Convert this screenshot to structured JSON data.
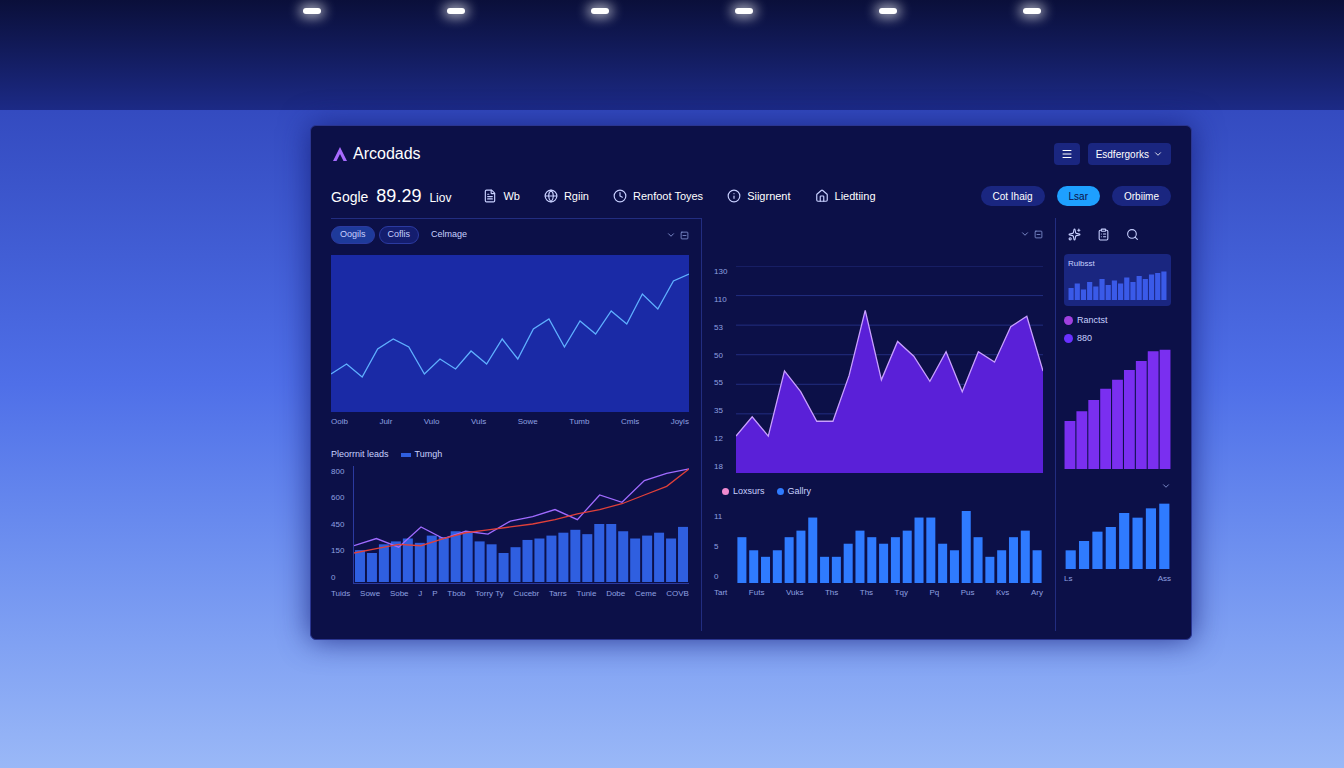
{
  "header": {
    "logo": "Arcodads",
    "dropdown": "Esdfergorks"
  },
  "toolbar": {
    "ticker": "Gogle",
    "value": "89.29",
    "unit": "Liov",
    "nav": [
      {
        "label": "Wb"
      },
      {
        "label": "Rgiin"
      },
      {
        "label": "Renfoot Toyes"
      },
      {
        "label": "Siigrnent"
      },
      {
        "label": "Liedtiing"
      }
    ],
    "buttons": [
      {
        "label": "Cot Ihaig",
        "selected": false
      },
      {
        "label": "Lsar",
        "selected": true
      },
      {
        "label": "Orbiime",
        "selected": false
      }
    ]
  },
  "left_panel": {
    "tabs": [
      {
        "label": "Oogils",
        "kind": "pill",
        "selected": true
      },
      {
        "label": "Coflis",
        "kind": "pill",
        "selected": false
      },
      {
        "label": "Celmage",
        "kind": "text",
        "selected": false
      }
    ],
    "trend_chart": {
      "values": [
        35,
        45,
        32,
        60,
        70,
        62,
        35,
        50,
        40,
        58,
        45,
        70,
        50,
        80,
        90,
        62,
        88,
        75,
        98,
        85,
        115,
        100,
        128,
        135
      ],
      "x_labels": [
        "Ooib",
        "Julr",
        "Vulo",
        "Vuls",
        "Sowe",
        "Tumb",
        "Cmls",
        "Joyls"
      ]
    },
    "leads_chart": {
      "title": "Pleorrnit leads",
      "legend": [
        {
          "label": "Tumgh",
          "color": "#2f5fe0"
        }
      ],
      "y_ticks": [
        "800",
        "600",
        "450",
        "150",
        "0"
      ],
      "bars": [
        220,
        200,
        260,
        280,
        300,
        270,
        320,
        310,
        350,
        340,
        280,
        260,
        200,
        240,
        290,
        300,
        320,
        340,
        360,
        330,
        400,
        400,
        350,
        300,
        320,
        340,
        300,
        380
      ],
      "lines": [
        {
          "values": [
            250,
            300,
            240,
            380,
            300,
            350,
            330,
            420,
            450,
            500,
            430,
            600,
            550,
            700,
            750,
            780
          ],
          "color": "#a06bff"
        },
        {
          "values": [
            200,
            230,
            260,
            250,
            300,
            340,
            360,
            380,
            400,
            430,
            470,
            500,
            540,
            600,
            660,
            780
          ],
          "color": "#e0403a"
        }
      ],
      "x_labels": [
        "Tuids",
        "Sowe",
        "Sobe",
        "J",
        "P",
        "Tbob",
        "Torry Ty",
        "Cucebr",
        "Tarrs",
        "Tunie",
        "Dobe",
        "Ceme",
        "COVB"
      ]
    }
  },
  "middle_panel": {
    "area_chart": {
      "y_ticks": [
        "130",
        "110",
        "53",
        "50",
        "55",
        "35",
        "12",
        "18"
      ],
      "values": [
        25,
        38,
        25,
        69,
        55,
        35,
        35,
        66,
        110,
        63,
        89,
        79,
        62,
        82,
        55,
        82,
        75,
        99,
        106,
        69
      ]
    },
    "legend": [
      {
        "label": "Loxsurs",
        "color": "#f08ad0"
      },
      {
        "label": "Gallry",
        "color": "#2f7bff"
      }
    ],
    "bar_chart": {
      "y_ticks": [
        "11",
        "5",
        "0"
      ],
      "values": [
        7,
        5,
        4,
        5,
        7,
        8,
        10,
        4,
        4,
        6,
        8,
        7,
        6,
        7,
        8,
        10,
        10,
        6,
        5,
        11,
        7,
        4,
        5,
        7,
        8,
        5
      ],
      "x_labels": [
        "Tart",
        "Futs",
        "Vuks",
        "Ths",
        "Ths",
        "Tqy",
        "Pq",
        "Pus",
        "Kvs",
        "Ary"
      ]
    }
  },
  "right_panel": {
    "mini_card": {
      "title": "Rulbsst",
      "values": [
        40,
        55,
        35,
        60,
        45,
        70,
        50,
        65,
        55,
        75,
        60,
        80,
        70,
        85,
        90,
        95
      ]
    },
    "legend": [
      {
        "label": "Ranctst",
        "color": "#a040e0"
      },
      {
        "label": "880",
        "color": "#6a30ff"
      }
    ],
    "purple_bars": [
      64,
      77,
      92,
      107,
      119,
      132,
      144,
      157,
      159
    ],
    "blue_bars": [
      20,
      30,
      40,
      45,
      60,
      55,
      65,
      70
    ],
    "x_labels": [
      "Ls",
      "Ass"
    ]
  }
}
